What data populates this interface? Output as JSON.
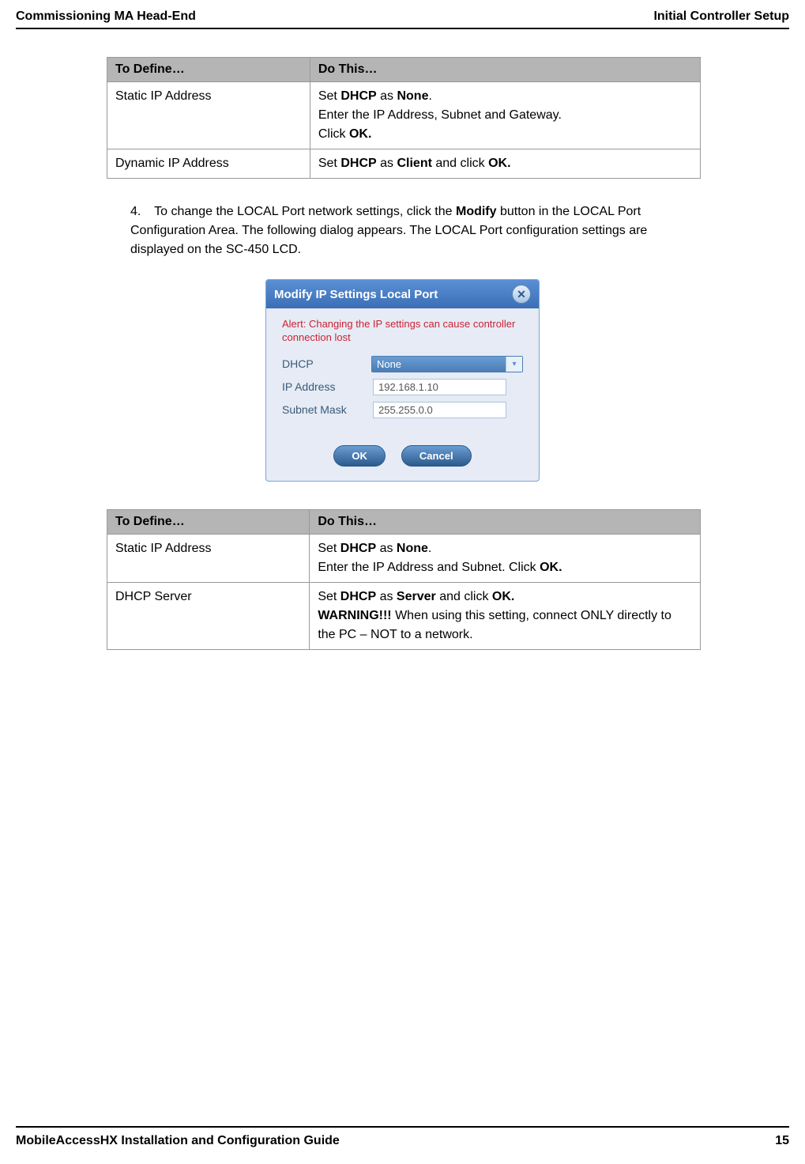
{
  "header": {
    "left": "Commissioning MA Head-End",
    "right": "Initial Controller Setup"
  },
  "table1": {
    "headers": {
      "c1": "To Define…",
      "c2": "Do This…"
    },
    "rows": [
      {
        "c1": "Static IP Address",
        "c2_line1_pre": "Set ",
        "c2_line1_b1": "DHCP",
        "c2_line1_mid": " as ",
        "c2_line1_b2": "None",
        "c2_line1_post": ".",
        "c2_line2": "Enter the IP Address, Subnet and Gateway.",
        "c2_line3_pre": "Click ",
        "c2_line3_b": "OK."
      },
      {
        "c1": "Dynamic IP Address",
        "c2_pre": "Set ",
        "c2_b1": "DHCP",
        "c2_mid1": " as ",
        "c2_b2": "Client",
        "c2_mid2": " and click ",
        "c2_b3": "OK."
      }
    ]
  },
  "step4": {
    "number": "4.",
    "text_pre": "To change the LOCAL Port network settings, click the ",
    "text_b": "Modify",
    "text_post": " button in the LOCAL Port Configuration Area. The following dialog appears. The LOCAL Port configuration settings are displayed on the SC-450 LCD."
  },
  "dialog": {
    "title": "Modify IP Settings Local Port",
    "alert": "Alert: Changing the IP settings can cause controller connection lost",
    "fields": {
      "dhcp_label": "DHCP",
      "dhcp_value": "None",
      "ip_label": "IP Address",
      "ip_value": "192.168.1.10",
      "subnet_label": "Subnet Mask",
      "subnet_value": "255.255.0.0"
    },
    "buttons": {
      "ok": "OK",
      "cancel": "Cancel"
    }
  },
  "table2": {
    "headers": {
      "c1": "To Define…",
      "c2": "Do This…"
    },
    "rows": [
      {
        "c1": "Static IP Address",
        "c2_line1_pre": "Set ",
        "c2_line1_b1": "DHCP",
        "c2_line1_mid": " as ",
        "c2_line1_b2": "None",
        "c2_line1_post": ".",
        "c2_line2_pre": "Enter the IP Address and Subnet. Click ",
        "c2_line2_b": "OK."
      },
      {
        "c1": "DHCP Server",
        "c2_line1_pre": "Set ",
        "c2_line1_b1": "DHCP",
        "c2_line1_mid1": " as ",
        "c2_line1_b2": "Server",
        "c2_line1_mid2": " and click ",
        "c2_line1_b3": "OK.",
        "c2_line2_b": "WARNING!!!",
        "c2_line2_post": " When using this setting, connect ONLY directly to the PC – NOT to a network."
      }
    ]
  },
  "footer": {
    "left": "MobileAccessHX Installation and Configuration Guide",
    "right": "15"
  }
}
